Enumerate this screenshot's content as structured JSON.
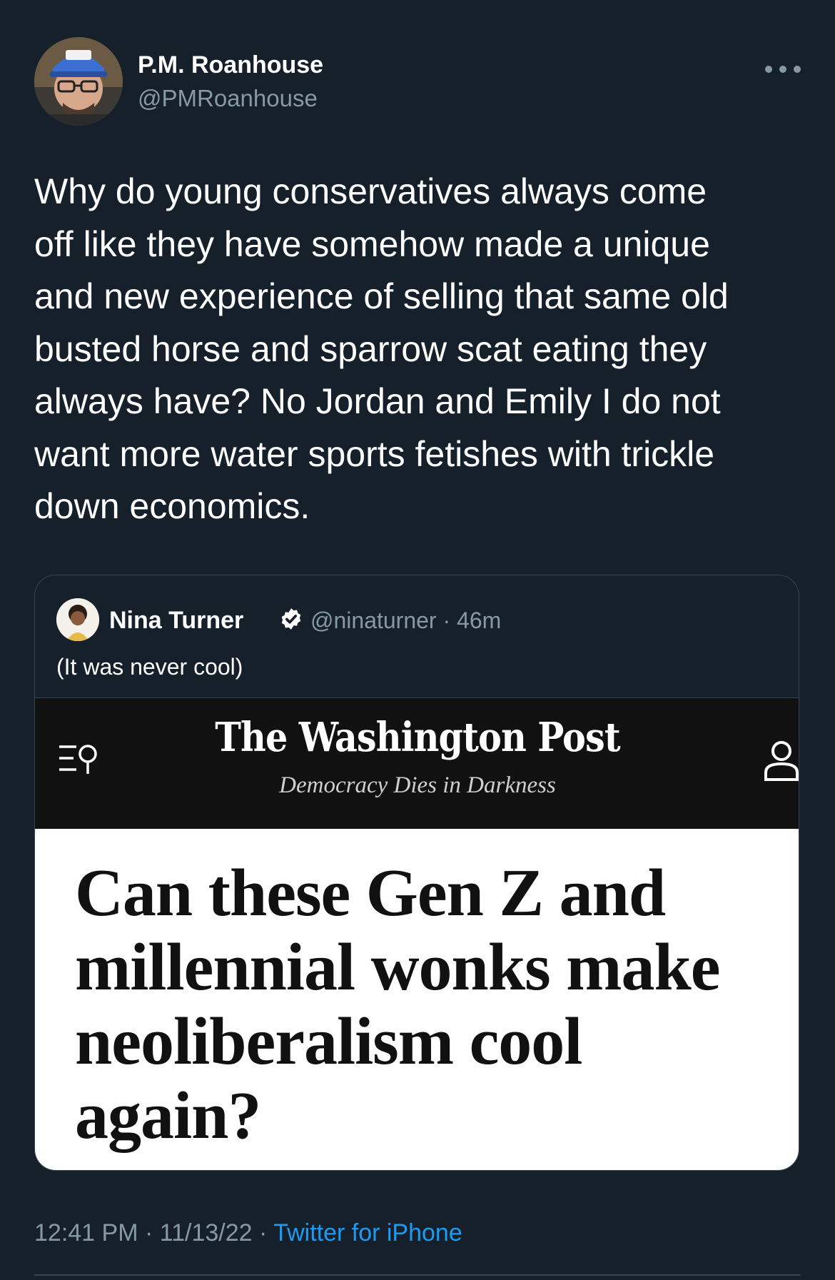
{
  "author": {
    "name": "P.M. Roanhouse",
    "handle": "@PMRoanhouse"
  },
  "tweet": {
    "text": "Why do young conservatives always come\noff like they have somehow made a unique\nand new experience of selling that same old\nbusted horse and sparrow scat eating they\nalways have? No Jordan and Emily I do not\nwant more water sports fetishes with trickle\ndown economics."
  },
  "quoted_tweet": {
    "name": "Nina Turner",
    "handle": "@ninaturner",
    "time": "46m",
    "text": "(It was never cool)",
    "image": {
      "masthead": "The Washington Post",
      "tagline": "Democracy Dies in Darkness",
      "headline": "Can these Gen Z and\nmillennial wonks make\nneoliberalism cool\nagain?"
    }
  },
  "meta": {
    "time": "12:41 PM",
    "date": "11/13/22",
    "source": "Twitter for iPhone"
  },
  "icons": [
    "more-icon",
    "verified-badge-icon",
    "menu-search-icon",
    "user-icon"
  ],
  "colors": {
    "background": "#15202b",
    "secondary_text": "#8899a6",
    "link": "#1d9bf0",
    "border": "#38444d"
  }
}
